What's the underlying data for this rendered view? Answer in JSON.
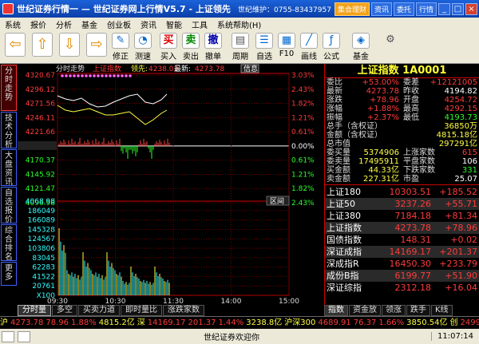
{
  "title_bar": {
    "title": "世纪证券行情一 — 世纪证券网上行情V5.7 - 上证领先",
    "hotline": "世纪维护：0755-83437957",
    "buttons": [
      "集合理财",
      "资讯",
      "委托",
      "行情"
    ]
  },
  "menu": [
    "系统",
    "报价",
    "分析",
    "基金",
    "创业板",
    "资讯",
    "智能",
    "工具",
    "系统帮助(H)"
  ],
  "toolbar": [
    {
      "icon": "back-icon",
      "label": ""
    },
    {
      "icon": "up-icon",
      "label": ""
    },
    {
      "icon": "down-icon",
      "label": ""
    },
    {
      "icon": "forward-icon",
      "label": ""
    },
    {
      "icon": "edit-icon",
      "label": "修正"
    },
    {
      "icon": "measure-icon",
      "label": "测速"
    },
    {
      "icon": "buy-icon",
      "label": "买入"
    },
    {
      "icon": "sell-icon",
      "label": "卖出"
    },
    {
      "icon": "cancel-order-icon",
      "label": "撤单"
    },
    {
      "icon": "period-icon",
      "label": "周期"
    },
    {
      "icon": "watchlist-icon",
      "label": "自选"
    },
    {
      "icon": "f10-icon",
      "label": "F10"
    },
    {
      "icon": "draw-line-icon",
      "label": "画线"
    },
    {
      "icon": "formula-icon",
      "label": "公式"
    },
    {
      "icon": "fund-icon",
      "label": "基金"
    },
    {
      "icon": "settings-icon",
      "label": ""
    }
  ],
  "left_tabs": [
    "分时走势",
    "技术分析",
    "大盘资讯",
    "自选报价",
    "综合排名",
    "更多"
  ],
  "chart": {
    "header_left": "分时走势",
    "header_index": "上证指数",
    "header_lead": "领先:",
    "header_lead_value": "4238.03",
    "header_latest": "最新:",
    "header_latest_value": "4273.78",
    "info_label": "信息",
    "price_ticks": [
      "4320.67",
      "4296.12",
      "4271.56",
      "4246.11",
      "4221.66",
      "4194.82",
      "4170.37",
      "4145.92",
      "4121.47",
      "4096.98"
    ],
    "pct_ticks": [
      "3.03%",
      "2.43%",
      "1.82%",
      "1.21%",
      "0.61%",
      "0.00%",
      "0.61%",
      "1.21%",
      "1.82%",
      "2.43%"
    ],
    "pct_colors": [
      "red",
      "red",
      "red",
      "red",
      "red",
      "wht",
      "grn",
      "grn",
      "grn",
      "grn"
    ],
    "price_colors": [
      "red",
      "red",
      "red",
      "red",
      "red",
      "wht",
      "grn",
      "grn",
      "grn",
      "grn"
    ],
    "volume_ticks": [
      "4068.98",
      "186049",
      "166089",
      "145328",
      "124567",
      "103806",
      "83045",
      "62283",
      "41522",
      "20761",
      "X100"
    ],
    "time_ticks": [
      "09:30",
      "10:30",
      "11:30",
      "14:00",
      "15:00"
    ],
    "section_label": "区间"
  },
  "info_panel": {
    "title": "上证指数 1A0001",
    "rows": [
      {
        "a": "委比",
        "b": "+53.00%",
        "bc": "red",
        "c": "委差",
        "d": "+12121005",
        "dc": "red"
      },
      {
        "a": "最新",
        "b": "4273.78",
        "bc": "red",
        "c": "昨收",
        "d": "4194.82",
        "dc": "wht"
      },
      {
        "a": "涨跌",
        "b": "+78.96",
        "bc": "red",
        "c": "开盘",
        "d": "4254.72",
        "dc": "red"
      },
      {
        "a": "涨幅",
        "b": "+1.88%",
        "bc": "red",
        "c": "最高",
        "d": "4292.15",
        "dc": "red"
      },
      {
        "a": "振幅",
        "b": "+2.37%",
        "bc": "red",
        "c": "最低",
        "d": "4193.73",
        "dc": "grn"
      },
      {
        "a": "总手（含权证）",
        "b": "",
        "bc": "yel",
        "c": "",
        "d": "36850万",
        "dc": "yel"
      },
      {
        "a": "金额（含权证）",
        "b": "",
        "bc": "yel",
        "c": "",
        "d": "4815.18亿",
        "dc": "yel"
      },
      {
        "a": "总市值",
        "b": "",
        "bc": "yel",
        "c": "",
        "d": "297291亿",
        "dc": "yel"
      },
      {
        "a": "委买量",
        "b": "5374906",
        "bc": "yel",
        "c": "上涨家数",
        "d": "615",
        "dc": "red"
      },
      {
        "a": "委卖量",
        "b": "17495911",
        "bc": "yel",
        "c": "平盘家数",
        "d": "106",
        "dc": "wht"
      },
      {
        "a": "买金额",
        "b": "44.33亿",
        "bc": "yel",
        "c": "下跌家数",
        "d": "331",
        "dc": "grn"
      },
      {
        "a": "卖金额",
        "b": "227.31亿",
        "bc": "yel",
        "c": "市盈",
        "d": "25.07",
        "dc": "wht"
      }
    ],
    "index_rows": [
      {
        "name": "上证180",
        "value": "10303.51",
        "vc": "red",
        "change": "+185.52",
        "cc": "red"
      },
      {
        "name": "上证50",
        "value": "3237.26",
        "vc": "red",
        "change": "+55.71",
        "cc": "red"
      },
      {
        "name": "上证380",
        "value": "7184.18",
        "vc": "red",
        "change": "+81.34",
        "cc": "red"
      },
      {
        "name": "上证指数",
        "value": "4273.78",
        "vc": "red",
        "change": "+78.96",
        "cc": "red"
      },
      {
        "name": "国债指数",
        "value": "148.31",
        "vc": "red",
        "change": "+0.02",
        "cc": "red"
      },
      {
        "name": "深证成指",
        "value": "14169.17",
        "vc": "red",
        "change": "+201.37",
        "cc": "red"
      },
      {
        "name": "深成指R",
        "value": "16450.30",
        "vc": "red",
        "change": "+233.79",
        "cc": "red"
      },
      {
        "name": "成份B指",
        "value": "6199.77",
        "vc": "red",
        "change": "+51.90",
        "cc": "red"
      },
      {
        "name": "深证综指",
        "value": "2312.18",
        "vc": "red",
        "change": "+16.04",
        "cc": "red"
      }
    ]
  },
  "bottom_tabs": [
    "分时量",
    "多空",
    "买卖力道",
    "即时量比",
    "涨跌家数"
  ],
  "right_bottom_tabs": [
    "指数",
    "资金放",
    "领涨",
    "跌手",
    "K线"
  ],
  "ticker": [
    {
      "t": "沪",
      "c": "yel"
    },
    {
      "t": "4273.78",
      "c": "red"
    },
    {
      "t": "78.96",
      "c": "red"
    },
    {
      "t": "1.88%",
      "c": "red"
    },
    {
      "t": "4815.2亿",
      "c": "yel"
    },
    {
      "t": "深",
      "c": "yel"
    },
    {
      "t": "14169.17",
      "c": "red"
    },
    {
      "t": "201.37",
      "c": "red"
    },
    {
      "t": "1.44%",
      "c": "red"
    },
    {
      "t": "3238.8亿",
      "c": "yel"
    },
    {
      "t": "沪深300",
      "c": "yel"
    },
    {
      "t": "4689.91",
      "c": "red"
    },
    {
      "t": "76.37",
      "c": "red"
    },
    {
      "t": "1.66%",
      "c": "red"
    },
    {
      "t": "3850.54亿",
      "c": "yel"
    },
    {
      "t": "创",
      "c": "yel"
    },
    {
      "t": "2499.32",
      "c": "red"
    },
    {
      "t": "14.90",
      "c": "red"
    },
    {
      "t": "0.60%",
      "c": "red"
    }
  ],
  "status": {
    "message": "世纪证券欢迎你",
    "clock": "11:07:14"
  },
  "colors": {
    "up": "#ff3b3b",
    "down": "#2bff2b",
    "title_bg": "#0b3fa8",
    "accent": "#ffff44"
  }
}
